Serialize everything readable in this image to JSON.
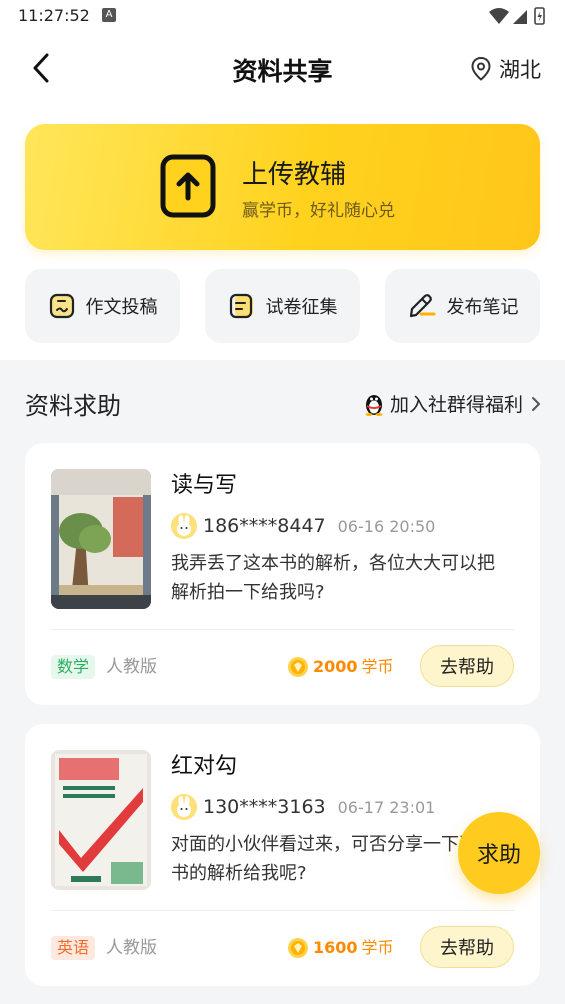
{
  "status_bar": {
    "time": "11:27:52",
    "badge": "A"
  },
  "header": {
    "back_icon": "chevron-left-icon",
    "title": "资料共享",
    "location_icon": "map-pin-icon",
    "location": "湖北"
  },
  "banner": {
    "title": "上传教辅",
    "subtitle": "赢学币，好礼随心兑",
    "icon": "upload-icon"
  },
  "quick_actions": [
    {
      "label": "作文投稿",
      "icon": "essay-icon"
    },
    {
      "label": "试卷征集",
      "icon": "paper-icon"
    },
    {
      "label": "发布笔记",
      "icon": "pencil-note-icon"
    }
  ],
  "section": {
    "title": "资料求助",
    "community_label": "加入社群得福利",
    "community_icon": "qq-penguin-icon"
  },
  "requests": [
    {
      "title": "读与写",
      "phone": "186****8447",
      "time": "06-16 20:50",
      "description": "我弄丢了这本书的解析，各位大大可以把解析拍一下给我吗?",
      "subject": "数学",
      "subject_color": "#2fae62",
      "subject_bg": "#e6f7ec",
      "edition": "人教版",
      "reward": "2000",
      "reward_unit": "学币",
      "action": "去帮助"
    },
    {
      "title": "红对勾",
      "phone": "130****3163",
      "time": "06-17 23:01",
      "description": "对面的小伙伴看过来，可否分享一下这本书的解析给我呢?",
      "subject": "英语",
      "subject_color": "#f26d2d",
      "subject_bg": "#fde9df",
      "edition": "人教版",
      "reward": "1600",
      "reward_unit": "学币",
      "action": "去帮助"
    }
  ],
  "fab": {
    "label": "求助"
  },
  "colors": {
    "accent": "#ffd21e",
    "reward": "#ff8a00"
  }
}
